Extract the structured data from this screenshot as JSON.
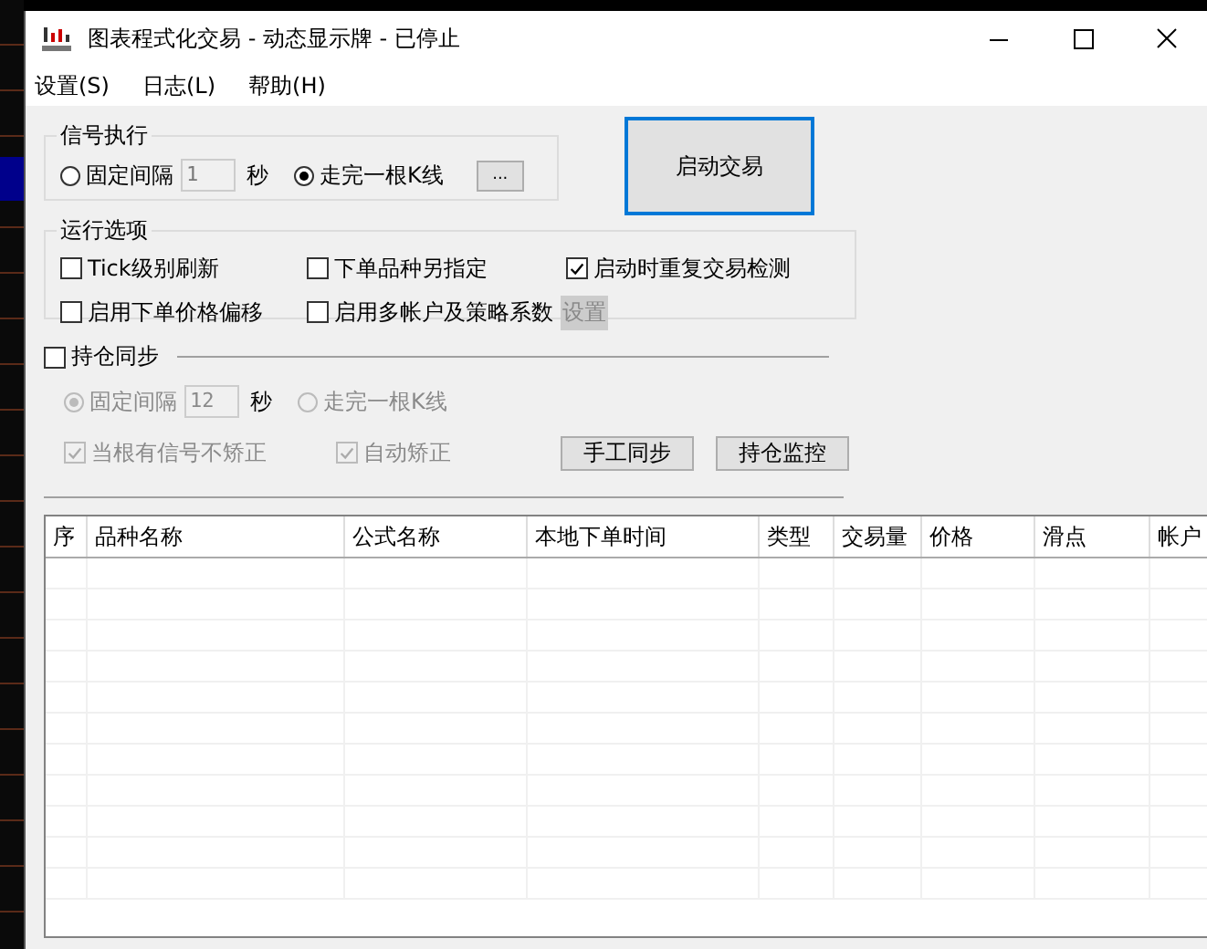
{
  "window": {
    "title": "图表程式化交易 - 动态显示牌 - 已停止"
  },
  "menu": [
    {
      "label": "设置(S)"
    },
    {
      "label": "日志(L)"
    },
    {
      "label": "帮助(H)"
    }
  ],
  "signal": {
    "title": "信号执行",
    "interval": {
      "label": "固定间隔",
      "selected": false,
      "value": "1",
      "unit": "秒"
    },
    "bar": {
      "label": "走完一根K线",
      "selected": true
    },
    "more_button": "..."
  },
  "start_button": "启动交易",
  "options": {
    "title": "运行选项",
    "items": [
      {
        "label": "Tick级别刷新",
        "checked": false
      },
      {
        "label": "下单品种另指定",
        "checked": false
      },
      {
        "label": "启动时重复交易检测",
        "checked": true
      },
      {
        "label": "启用下单价格偏移",
        "checked": false
      },
      {
        "label": "启用多帐户及策略系数",
        "checked": false
      }
    ],
    "settings_button": {
      "label": "设置",
      "disabled": true
    }
  },
  "sync": {
    "label": "持仓同步",
    "checked": false,
    "interval": {
      "label": "固定间隔",
      "selected": true,
      "disabled": true,
      "value": "12",
      "unit": "秒"
    },
    "bar": {
      "label": "走完一根K线",
      "selected": false,
      "disabled": true
    },
    "checks": [
      {
        "label": "当根有信号不矫正",
        "checked": true,
        "disabled": true
      },
      {
        "label": "自动矫正",
        "checked": true,
        "disabled": true
      }
    ],
    "buttons": [
      "手工同步",
      "持仓监控"
    ]
  },
  "table": {
    "columns": [
      "序",
      "品种名称",
      "公式名称",
      "本地下单时间",
      "类型",
      "交易量",
      "价格",
      "滑点",
      "帐户"
    ]
  }
}
